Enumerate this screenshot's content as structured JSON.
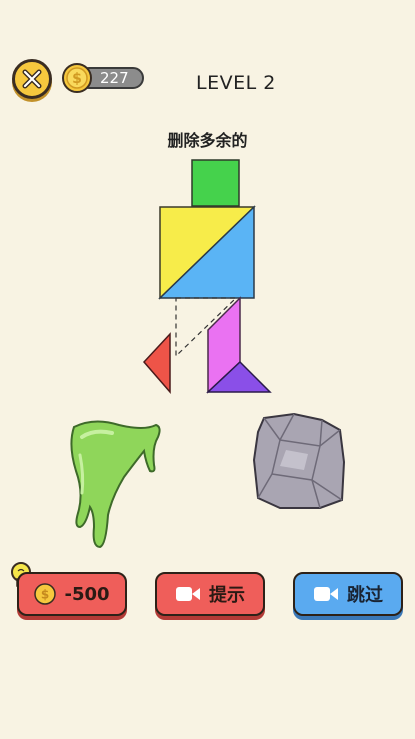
{
  "header": {
    "coins": "227",
    "level": "LEVEL 2"
  },
  "instruction": "删除多余的",
  "buttons": {
    "hint_cost": "-500",
    "hint_label": "提示",
    "skip_label": "跳过"
  },
  "colors": {
    "background": "#f8f3e3",
    "green": "#45d24c",
    "yellow": "#f7ec4a",
    "blue": "#5ab4f5",
    "pink": "#ea72f2",
    "purple": "#8a4fe8",
    "red": "#ee5448",
    "slime": "#8fd65a",
    "rock": "#a9a5b2",
    "button_red": "#ef5e5a",
    "button_blue": "#5aaaf0"
  },
  "icons": [
    "close-icon",
    "coin-icon",
    "lightbulb-icon",
    "video-icon"
  ]
}
